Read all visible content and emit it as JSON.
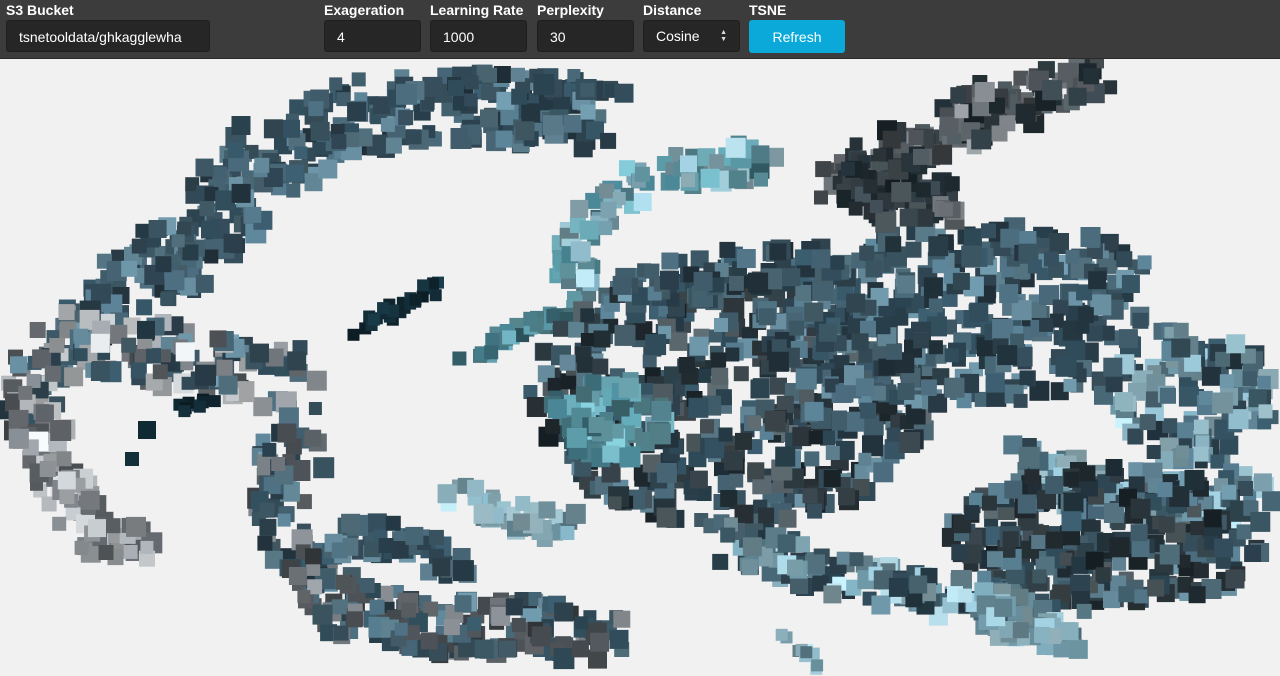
{
  "toolbar": {
    "bucket": {
      "label": "S3 Bucket",
      "value": "tsnetooldata/ghkagglewha"
    },
    "exaggeration": {
      "label": "Exageration",
      "value": "4"
    },
    "learning_rate": {
      "label": "Learning Rate",
      "value": "1000"
    },
    "perplexity": {
      "label": "Perplexity",
      "value": "30"
    },
    "distance": {
      "label": "Distance",
      "value": "Cosine",
      "options": [
        "Cosine"
      ]
    },
    "tsne": {
      "label": "TSNE",
      "button_label": "Refresh"
    }
  },
  "colors": {
    "toolbar_bg": "#3c3c3c",
    "input_bg": "#262626",
    "accent": "#0aa9d9",
    "canvas_bg": "#f1f1f1"
  }
}
